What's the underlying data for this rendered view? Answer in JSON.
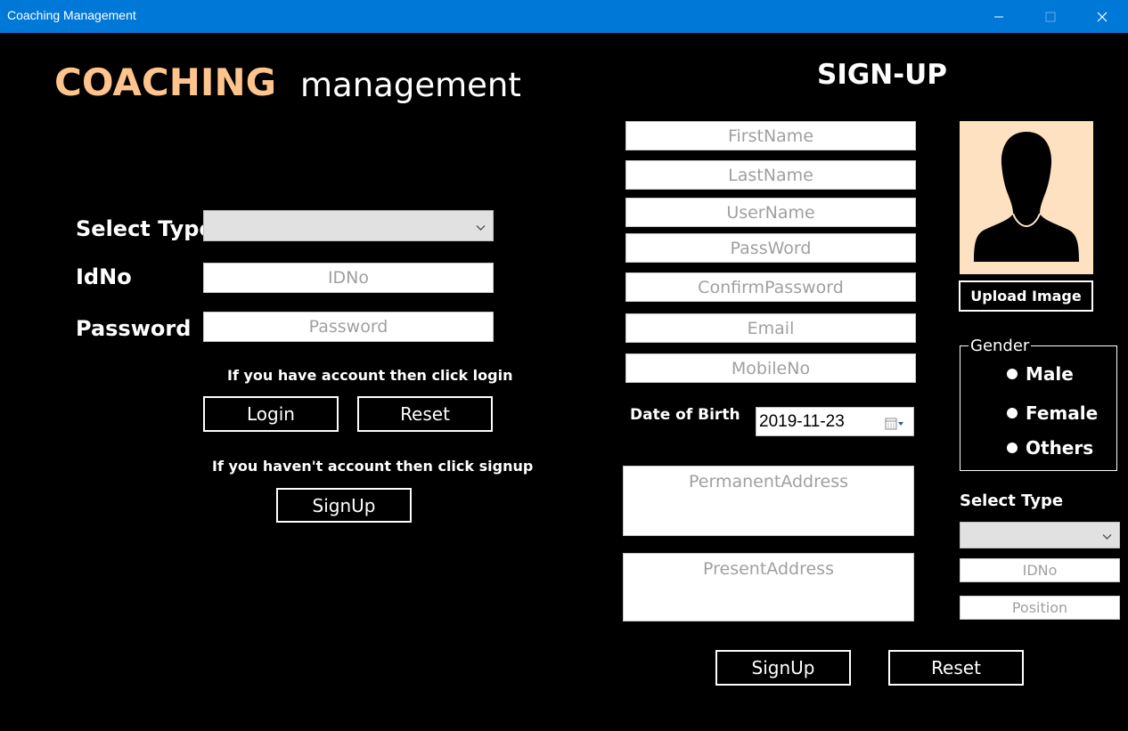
{
  "window": {
    "title": "Coaching Management"
  },
  "brand": {
    "part1": "COACHING",
    "part2": "management"
  },
  "login": {
    "select_type_label": "Select Type",
    "select_type_value": "",
    "idno_label": "IdNo",
    "idno_placeholder": "IDNo",
    "password_label": "Password",
    "password_placeholder": "Password",
    "login_hint": "If you have account then click login",
    "login_button": "Login",
    "reset_button": "Reset",
    "signup_hint": "If you haven't account then click signup",
    "signup_button": "SignUp"
  },
  "signup": {
    "title": "SIGN-UP",
    "first_name_placeholder": "FirstName",
    "last_name_placeholder": "LastName",
    "user_name_placeholder": "UserName",
    "password_placeholder": "PassWord",
    "confirm_password_placeholder": "ConfirmPassword",
    "email_placeholder": "Email",
    "mobile_placeholder": "MobileNo",
    "dob_label": "Date of Birth",
    "dob_value": "2019-11-23",
    "permanent_address_placeholder": "PermanentAddress",
    "present_address_placeholder": "PresentAddress",
    "upload_button": "Upload Image",
    "gender_legend": "Gender",
    "gender_options": [
      "Male",
      "Female",
      "Others"
    ],
    "select_type_label": "Select Type",
    "select_type_value": "",
    "idno_placeholder": "IDNo",
    "position_placeholder": "Position",
    "signup_button": "SignUp",
    "reset_button": "Reset"
  },
  "colors": {
    "titlebar": "#0078d7",
    "brand_accent": "#fec48b",
    "avatar_bg": "#fde1c0",
    "background": "#000000"
  },
  "icons": [
    "minimize-icon",
    "maximize-icon",
    "close-icon",
    "chevron-down-icon",
    "calendar-icon",
    "user-silhouette-icon"
  ]
}
